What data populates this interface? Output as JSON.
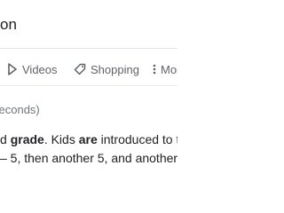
{
  "search": {
    "query_fragment": "on"
  },
  "tabs": [
    {
      "label": "Videos",
      "icon": "play-icon"
    },
    {
      "label": "Shopping",
      "icon": "tag-icon"
    },
    {
      "label": "Mor",
      "icon": "more-vertical-icon"
    }
  ],
  "results": {
    "stats_fragment": "seconds)"
  },
  "snippet": {
    "line1": {
      "t1": "d ",
      "b1": "grade",
      "t2": ". Kids ",
      "b2": "are",
      "t3": " introduced to t"
    },
    "line2": "– 5, then another 5, and another"
  },
  "colors": {
    "text": "#202124",
    "tab_text": "#5f6368",
    "stats_text": "#70757a",
    "divider": "#e6e6e6"
  }
}
